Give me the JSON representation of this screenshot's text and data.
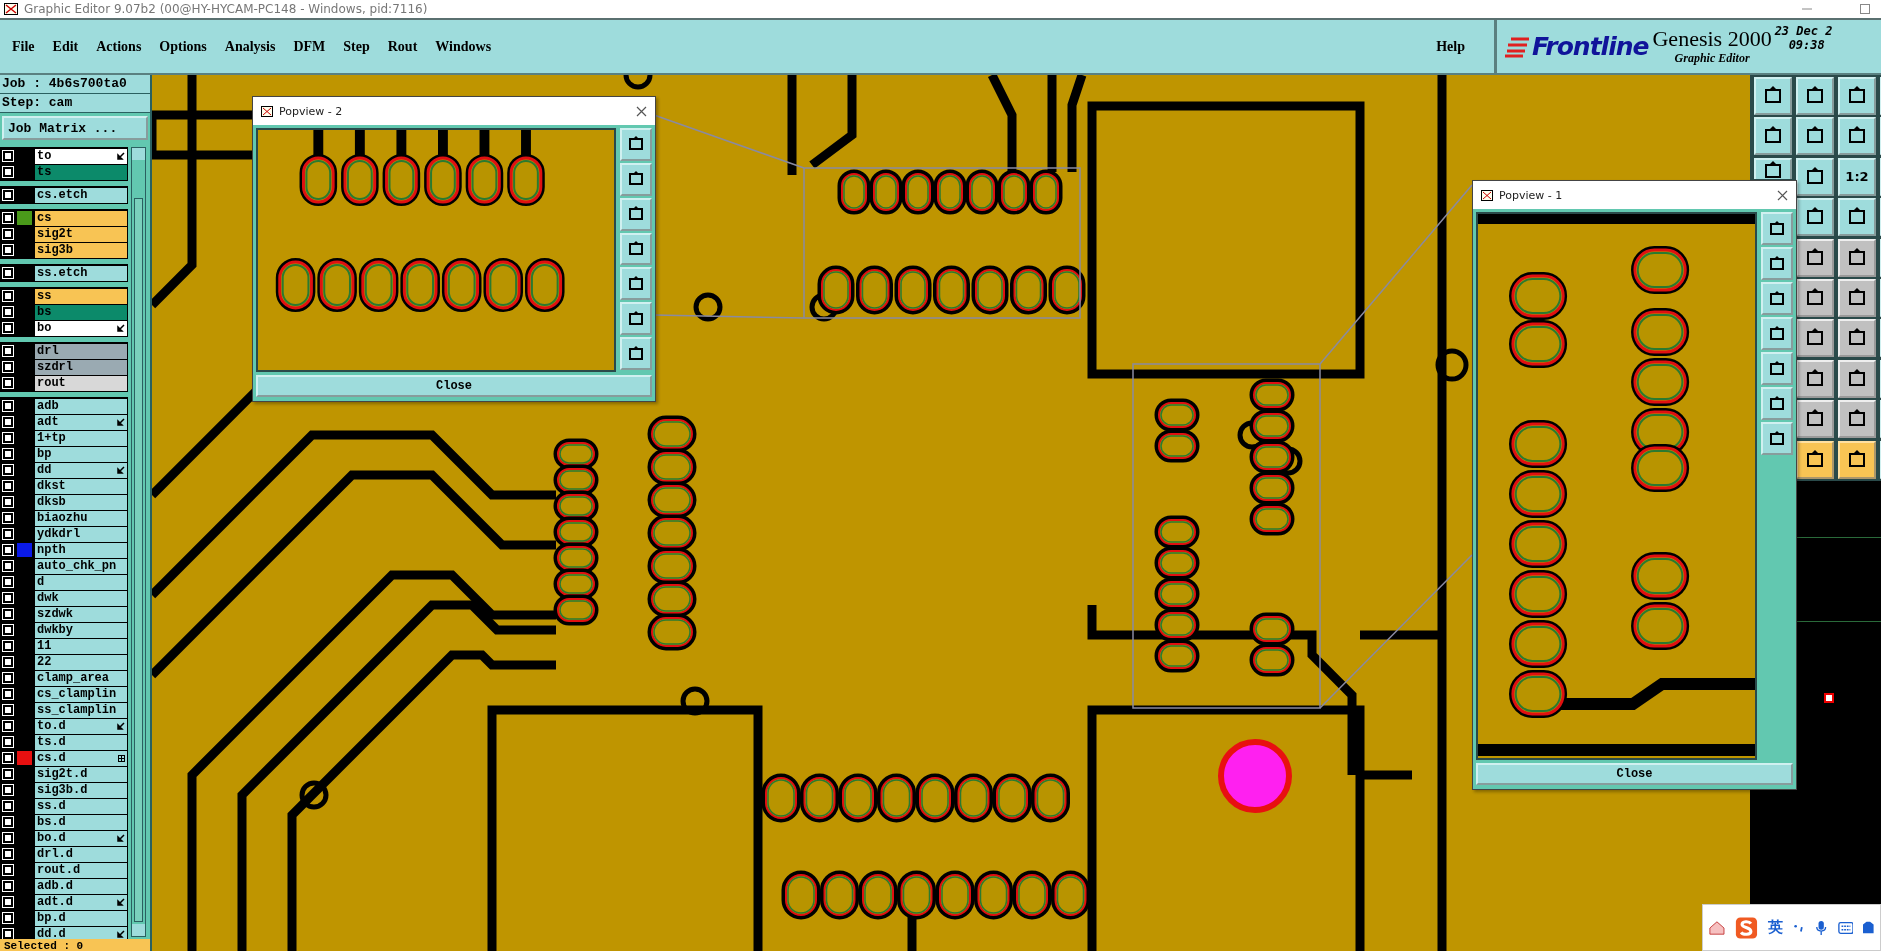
{
  "window": {
    "title": "Graphic Editor 9.07b2 (00@HY-HYCAM-PC148 - Windows, pid:7116)"
  },
  "menu": [
    "File",
    "Edit",
    "Actions",
    "Options",
    "Analysis",
    "DFM",
    "Step",
    "Rout",
    "Windows"
  ],
  "help": "Help",
  "brand": {
    "logo": "Frontline",
    "product": "Genesis 2000",
    "subtitle": "Graphic Editor",
    "date": "23 Dec 2",
    "time": "09:38"
  },
  "job": {
    "job_label": "Job : 4b6s700ta0",
    "step_label": "Step: cam",
    "matrix_button": "Job Matrix ..."
  },
  "layer_groups": [
    [
      {
        "name": "to",
        "kind": "silk",
        "checked": false,
        "arrow": true,
        "grid": false
      },
      {
        "name": "ts",
        "kind": "mask",
        "checked": false,
        "arrow": false,
        "grid": false
      }
    ],
    [
      {
        "name": "cs.etch",
        "kind": "misc",
        "checked": false,
        "arrow": false,
        "grid": false
      }
    ],
    [
      {
        "name": "cs",
        "kind": "signal",
        "color": "#4a9a1a",
        "checked": false,
        "arrow": false,
        "grid": false
      },
      {
        "name": "sig2t",
        "kind": "signal",
        "checked": false,
        "arrow": false,
        "grid": false
      },
      {
        "name": "sig3b",
        "kind": "signal",
        "checked": false,
        "arrow": false,
        "grid": false
      }
    ],
    [
      {
        "name": "ss.etch",
        "kind": "misc",
        "checked": false,
        "arrow": false,
        "grid": false
      }
    ],
    [
      {
        "name": "ss",
        "kind": "signal",
        "checked": false,
        "arrow": false,
        "grid": false
      },
      {
        "name": "bs",
        "kind": "mask",
        "checked": false,
        "arrow": false,
        "grid": false
      },
      {
        "name": "bo",
        "kind": "silk",
        "checked": false,
        "arrow": true,
        "grid": false
      }
    ],
    [
      {
        "name": "drl",
        "kind": "drill",
        "checked": false,
        "arrow": false,
        "grid": false
      },
      {
        "name": "szdrl",
        "kind": "drill",
        "checked": false,
        "arrow": false,
        "grid": false
      },
      {
        "name": "rout",
        "kind": "rout",
        "checked": false,
        "arrow": false,
        "grid": false
      }
    ],
    [
      {
        "name": "adb",
        "kind": "misc",
        "checked": false,
        "arrow": false,
        "grid": false
      },
      {
        "name": "adt",
        "kind": "misc",
        "checked": false,
        "arrow": true,
        "grid": false
      },
      {
        "name": "1+tp",
        "kind": "misc",
        "checked": false,
        "arrow": false,
        "grid": false
      },
      {
        "name": "bp",
        "kind": "misc",
        "checked": false,
        "arrow": false,
        "grid": false
      },
      {
        "name": "dd",
        "kind": "misc",
        "checked": false,
        "arrow": true,
        "grid": false
      },
      {
        "name": "dkst",
        "kind": "misc",
        "checked": false,
        "arrow": false,
        "grid": false
      },
      {
        "name": "dksb",
        "kind": "misc",
        "checked": false,
        "arrow": false,
        "grid": false
      },
      {
        "name": "biaozhu",
        "kind": "misc",
        "checked": false,
        "arrow": false,
        "grid": false
      },
      {
        "name": "ydkdrl",
        "kind": "misc",
        "checked": false,
        "arrow": false,
        "grid": false
      },
      {
        "name": "npth",
        "kind": "misc",
        "color": "#0a1ae8",
        "checked": false,
        "arrow": false,
        "grid": false
      },
      {
        "name": "auto_chk_pn",
        "kind": "misc",
        "checked": false,
        "arrow": false,
        "grid": false
      },
      {
        "name": "d",
        "kind": "misc",
        "checked": false,
        "arrow": false,
        "grid": false
      },
      {
        "name": "dwk",
        "kind": "misc",
        "checked": false,
        "arrow": false,
        "grid": false
      },
      {
        "name": "szdwk",
        "kind": "misc",
        "checked": false,
        "arrow": false,
        "grid": false
      },
      {
        "name": "dwkby",
        "kind": "misc",
        "checked": false,
        "arrow": false,
        "grid": false
      },
      {
        "name": "11",
        "kind": "misc",
        "checked": false,
        "arrow": false,
        "grid": false
      },
      {
        "name": "22",
        "kind": "misc",
        "checked": false,
        "arrow": false,
        "grid": false
      },
      {
        "name": "clamp_area",
        "kind": "misc",
        "checked": false,
        "arrow": false,
        "grid": false
      },
      {
        "name": "cs_clamplin",
        "kind": "misc",
        "checked": false,
        "arrow": false,
        "grid": false
      },
      {
        "name": "ss_clamplin",
        "kind": "misc",
        "checked": false,
        "arrow": false,
        "grid": false
      },
      {
        "name": "to.d",
        "kind": "misc",
        "checked": false,
        "arrow": true,
        "grid": false
      },
      {
        "name": "ts.d",
        "kind": "misc",
        "checked": false,
        "arrow": false,
        "grid": false
      },
      {
        "name": "cs.d",
        "kind": "misc",
        "color": "#e81010",
        "checked": false,
        "arrow": false,
        "grid": true
      },
      {
        "name": "sig2t.d",
        "kind": "misc",
        "checked": false,
        "arrow": false,
        "grid": false
      },
      {
        "name": "sig3b.d",
        "kind": "misc",
        "checked": false,
        "arrow": false,
        "grid": false
      },
      {
        "name": "ss.d",
        "kind": "misc",
        "checked": false,
        "arrow": false,
        "grid": false
      },
      {
        "name": "bs.d",
        "kind": "misc",
        "checked": false,
        "arrow": false,
        "grid": false
      },
      {
        "name": "bo.d",
        "kind": "misc",
        "checked": false,
        "arrow": true,
        "grid": false
      },
      {
        "name": "drl.d",
        "kind": "misc",
        "checked": false,
        "arrow": false,
        "grid": false
      },
      {
        "name": "rout.d",
        "kind": "misc",
        "checked": false,
        "arrow": false,
        "grid": false
      },
      {
        "name": "adb.d",
        "kind": "misc",
        "checked": false,
        "arrow": false,
        "grid": false
      },
      {
        "name": "adt.d",
        "kind": "misc",
        "checked": false,
        "arrow": true,
        "grid": false
      },
      {
        "name": "bp.d",
        "kind": "misc",
        "checked": false,
        "arrow": false,
        "grid": false
      },
      {
        "name": "dd.d",
        "kind": "misc",
        "checked": false,
        "arrow": true,
        "grid": false
      }
    ]
  ],
  "selected_status": "Selected : 0",
  "scale_button": "1:2",
  "popviews": [
    {
      "title": "Popview - 2",
      "close": "Close"
    },
    {
      "title": "Popview - 1",
      "close": "Close"
    }
  ],
  "ime": {
    "mode": "英"
  }
}
